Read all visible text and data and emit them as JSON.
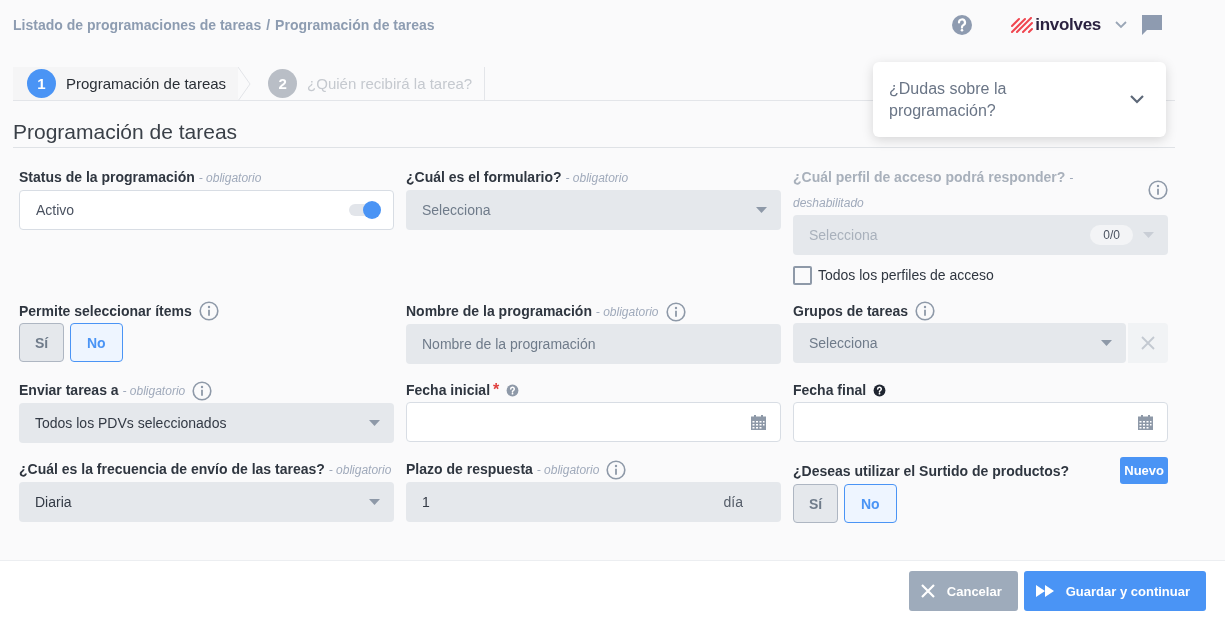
{
  "breadcrumb": {
    "items": [
      "Listado de programaciones de tareas",
      "Programación de tareas"
    ],
    "separator": "/"
  },
  "header": {
    "brand": "involves"
  },
  "stepper": [
    {
      "number": "1",
      "label": "Programación de tareas",
      "selected": true
    },
    {
      "number": "2",
      "label": "¿Quién recibirá la tarea?",
      "selected": false
    }
  ],
  "help_panel": {
    "title": "¿Dudas sobre la programación?",
    "expanded": false
  },
  "section_title": "Programación de tareas",
  "fields": [
    {
      "kind": "toggle",
      "label": "Status de la programación *- obligatorio*",
      "value": "Activo",
      "on": true
    },
    {
      "kind": "select",
      "label": "¿Cuál es el formulario? *- obligatorio*",
      "placeholder": "Selecciona"
    },
    {
      "kind": "select",
      "label": "¿Cuál perfil de acceso podrá responder? *- deshabilitado*",
      "info": true,
      "disabled": true,
      "placeholder": "Selecciona",
      "count": "0/0",
      "checkbox": {
        "label": "Todos los perfiles de acceso",
        "checked": false
      }
    },
    {
      "kind": "choice",
      "label": "Permite seleccionar ítems",
      "info": true,
      "options": [
        {
          "label": "Sí",
          "selected": false
        },
        {
          "label": "No",
          "selected": true
        }
      ]
    },
    {
      "kind": "text",
      "label": "Nombre de la programación *- obligatorio*",
      "info": true,
      "placeholder": "Nombre de la programación"
    },
    {
      "kind": "select",
      "label": "Grupos de tareas",
      "info": true,
      "placeholder": "Selecciona",
      "clearable": true
    },
    {
      "kind": "select",
      "label": "Enviar tareas a *- obligatorio*",
      "info": true,
      "value": "Todos los PDVs seleccionados"
    },
    {
      "kind": "date",
      "label": "Fecha inicial",
      "required_mark": "*",
      "help_icon": {
        "color": "#8e99a8"
      }
    },
    {
      "kind": "date",
      "label": "Fecha final",
      "help_icon": {
        "color": "#1f2530"
      }
    },
    {
      "kind": "select",
      "label": "¿Cuál es la frecuencia de envío de las tareas? *- obligatorio*",
      "value": "Diaria"
    },
    {
      "kind": "number",
      "label": "Plazo de respuesta *- obligatorio*",
      "info": true,
      "value": "1",
      "unit": "día"
    },
    {
      "kind": "choice",
      "label": "¿Deseas utilizar el Surtido de productos?",
      "badge": "Nuevo",
      "options": [
        {
          "label": "Sí",
          "selected": false
        },
        {
          "label": "No",
          "selected": true
        }
      ]
    }
  ],
  "footer_buttons": [
    {
      "label": "Cancelar",
      "kind": "cancel"
    },
    {
      "label": "Guardar y continuar",
      "kind": "save"
    }
  ]
}
